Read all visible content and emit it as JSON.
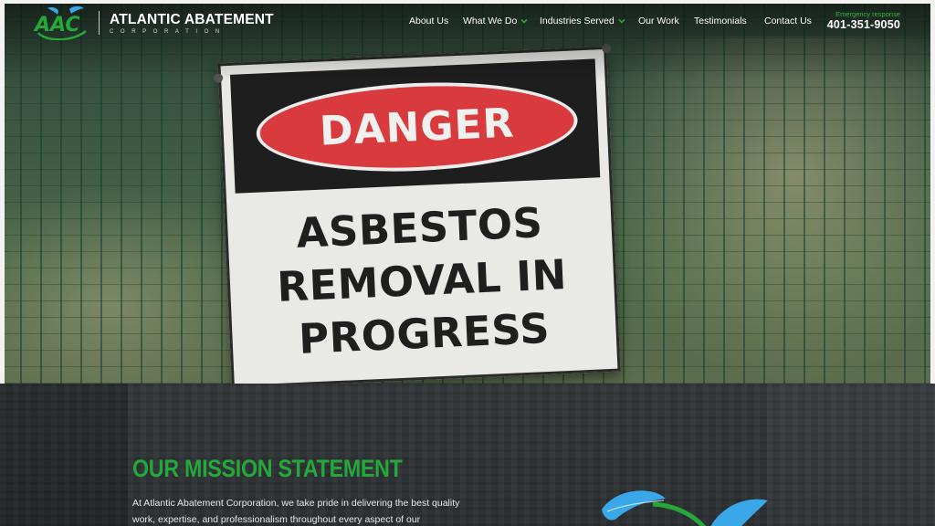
{
  "brand": {
    "logo_text": "AAC",
    "name": "ATLANTIC ABATEMENT",
    "subtitle": "CORPORATION"
  },
  "nav": {
    "items": [
      {
        "label": "About Us",
        "has_dropdown": false
      },
      {
        "label": "What We Do",
        "has_dropdown": true
      },
      {
        "label": "Industries Served",
        "has_dropdown": true
      },
      {
        "label": "Our Work",
        "has_dropdown": false
      },
      {
        "label": "Testimonials",
        "has_dropdown": false
      },
      {
        "label": "Contact Us",
        "has_dropdown": false
      }
    ]
  },
  "emergency": {
    "label": "Emergency response",
    "phone": "401-351-9050"
  },
  "hero": {
    "sign_header": "DANGER",
    "sign_lines": [
      "ASBESTOS",
      "REMOVAL IN",
      "PROGRESS"
    ]
  },
  "mission": {
    "title": "OUR MISSION STATEMENT",
    "text": "At Atlantic Abatement Corporation, we take pride in delivering the best quality work, expertise, and professionalism throughout every aspect of our"
  },
  "colors": {
    "accent_green": "#25a83a",
    "leaf_blue": "#3aa8e8",
    "danger_red": "#d93a3d",
    "footer_bg": "#2c3033"
  },
  "icons": {
    "logo": "aac-leaf-logo",
    "dropdown": "chevron-down-icon",
    "leaves": "leaf-graphic"
  }
}
